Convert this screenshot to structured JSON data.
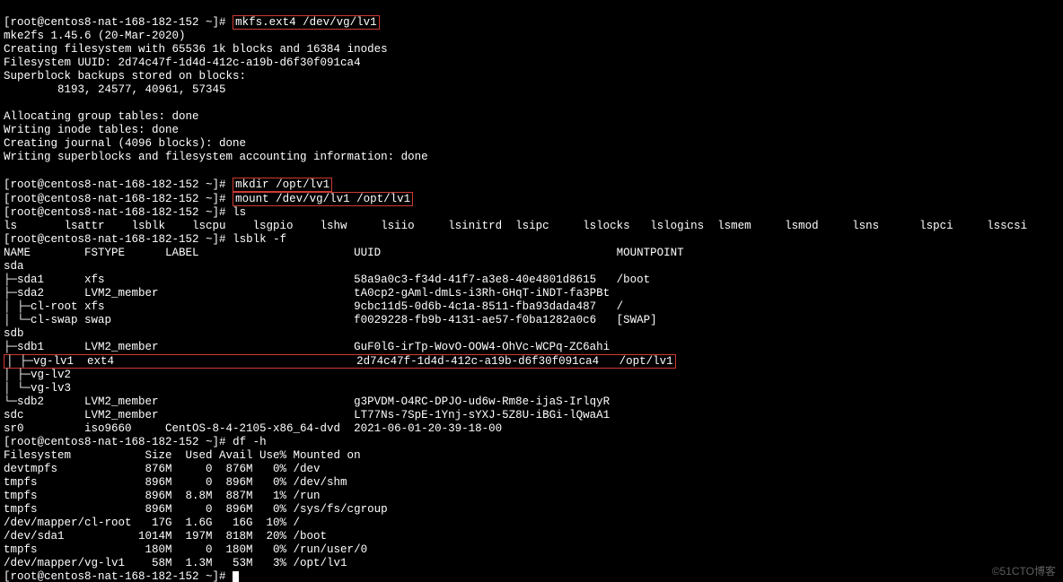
{
  "prompt": "[root@centos8-nat-168-182-152 ~]#",
  "cmd1": "mkfs.ext4 /dev/vg/lv1",
  "mke2fs": {
    "l1": "mke2fs 1.45.6 (20-Mar-2020)",
    "l2": "Creating filesystem with 65536 1k blocks and 16384 inodes",
    "l3": "Filesystem UUID: 2d74c47f-1d4d-412c-a19b-d6f30f091ca4",
    "l4": "Superblock backups stored on blocks:",
    "l5": "        8193, 24577, 40961, 57345",
    "l6": "Allocating group tables: done",
    "l7": "Writing inode tables: done",
    "l8": "Creating journal (4096 blocks): done",
    "l9": "Writing superblocks and filesystem accounting information: done"
  },
  "cmd2": "mkdir /opt/lv1",
  "cmd3": "mount /dev/vg/lv1 /opt/lv1",
  "cmd4": "ls",
  "lsrow": "ls       lsattr    lsblk    lscpu    lsgpio    lshw     lsiio     lsinitrd  lsipc     lslocks   lslogins  lsmem     lsmod     lsns      lspci     lsscsi",
  "cmd5": "lsblk -f",
  "lsblk": {
    "hdr": "NAME        FSTYPE      LABEL                       UUID                                   MOUNTPOINT",
    "r0": "sda",
    "r1": "├─sda1      xfs                                     58a9a0c3-f34d-41f7-a3e8-40e4801d8615   /boot",
    "r2": "├─sda2      LVM2_member                             tA0cp2-gAml-dmLs-i3Rh-GHqT-iNDT-fa3PBt",
    "r3": "│ ├─cl-root xfs                                     9cbc11d5-0d6b-4c1a-8511-fba93dada487   /",
    "r4": "│ └─cl-swap swap                                    f0029228-fb9b-4131-ae57-f0ba1282a0c6   [SWAP]",
    "r5": "sdb",
    "r6": "├─sdb1      LVM2_member                             GuF0lG-irTp-WovO-OOW4-OhVc-WCPq-ZC6ahi",
    "r7": "│ ├─vg-lv1  ext4                                    2d74c47f-1d4d-412c-a19b-d6f30f091ca4   /opt/lv1",
    "r8": "│ ├─vg-lv2",
    "r9": "│ └─vg-lv3",
    "r10": "└─sdb2      LVM2_member                             g3PVDM-O4RC-DPJO-ud6w-Rm8e-ijaS-IrlqyR",
    "r11": "sdc         LVM2_member                             LT77Ns-7SpE-1Ynj-sYXJ-5Z8U-iBGi-lQwaA1",
    "r12": "sr0         iso9660     CentOS-8-4-2105-x86_64-dvd  2021-06-01-20-39-18-00"
  },
  "cmd6": "df -h",
  "df": {
    "hdr": "Filesystem           Size  Used Avail Use% Mounted on",
    "r1": "devtmpfs             876M     0  876M   0% /dev",
    "r2": "tmpfs                896M     0  896M   0% /dev/shm",
    "r3": "tmpfs                896M  8.8M  887M   1% /run",
    "r4": "tmpfs                896M     0  896M   0% /sys/fs/cgroup",
    "r5": "/dev/mapper/cl-root   17G  1.6G   16G  10% /",
    "r6": "/dev/sda1           1014M  197M  818M  20% /boot",
    "r7": "tmpfs                180M     0  180M   0% /run/user/0",
    "r8": "/dev/mapper/vg-lv1    58M  1.3M   53M   3% /opt/lv1"
  },
  "watermark": "©51CTO博客"
}
